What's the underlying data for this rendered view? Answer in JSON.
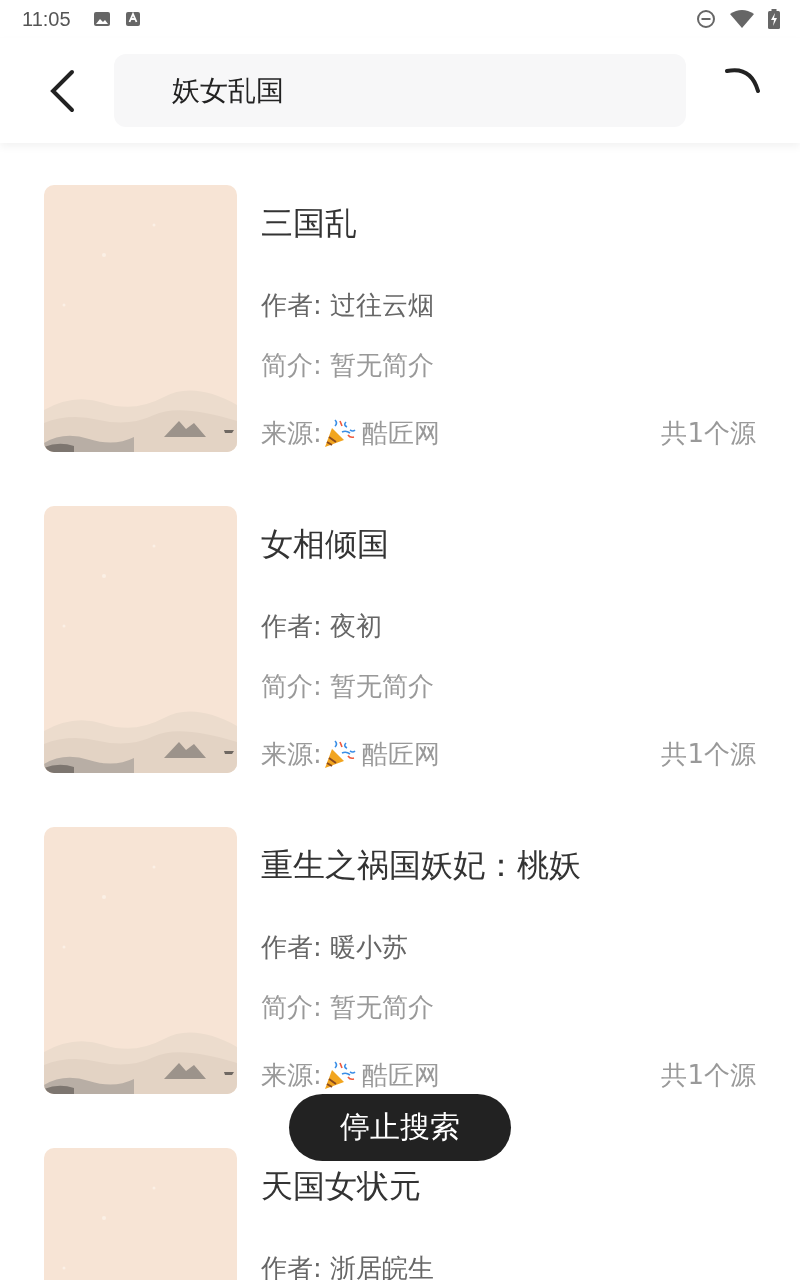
{
  "status_bar": {
    "time": "11:05"
  },
  "search": {
    "value": "妖女乱国",
    "loading": true
  },
  "results": [
    {
      "title": "三国乱",
      "author_label": "作者:",
      "author": "过往云烟",
      "intro_label": "简介:",
      "intro": "暂无简介",
      "source_label": "来源:",
      "source": "酷匠网",
      "source_count": "共1个源"
    },
    {
      "title": "女相倾国",
      "author_label": "作者:",
      "author": "夜初",
      "intro_label": "简介:",
      "intro": "暂无简介",
      "source_label": "来源:",
      "source": "酷匠网",
      "source_count": "共1个源"
    },
    {
      "title": "重生之祸国妖妃：桃妖",
      "author_label": "作者:",
      "author": "暖小苏",
      "intro_label": "简介:",
      "intro": "暂无简介",
      "source_label": "来源:",
      "source": "酷匠网",
      "source_count": "共1个源"
    },
    {
      "title": "天国女状元",
      "author_label": "作者:",
      "author": "浙居皖生"
    }
  ],
  "stop_button": {
    "label": "停止搜索"
  }
}
